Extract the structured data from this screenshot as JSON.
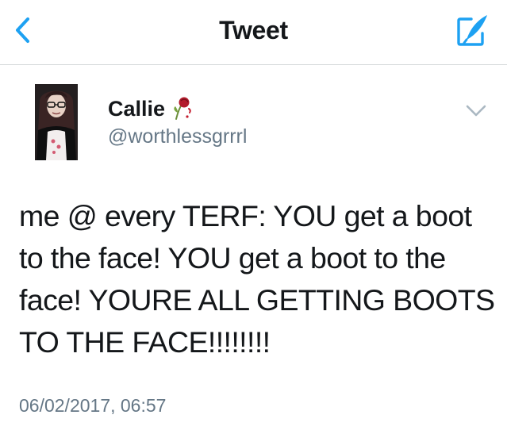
{
  "header": {
    "title": "Tweet",
    "back_icon": "chevron-left-icon",
    "compose_icon": "compose-quill-icon",
    "accent_color": "#1da1f2"
  },
  "tweet": {
    "author": {
      "display_name": "Callie",
      "handle": "@worthlessgrrrl",
      "name_emoji": "wilted-rose-icon"
    },
    "text": "me @ every TERF: YOU get a boot to the face! YOU get a boot to the face! YOURE ALL GETTING BOOTS TO THE FACE!!!!!!!!",
    "timestamp": "06/02/2017, 06:57",
    "menu_icon": "chevron-down-icon"
  }
}
